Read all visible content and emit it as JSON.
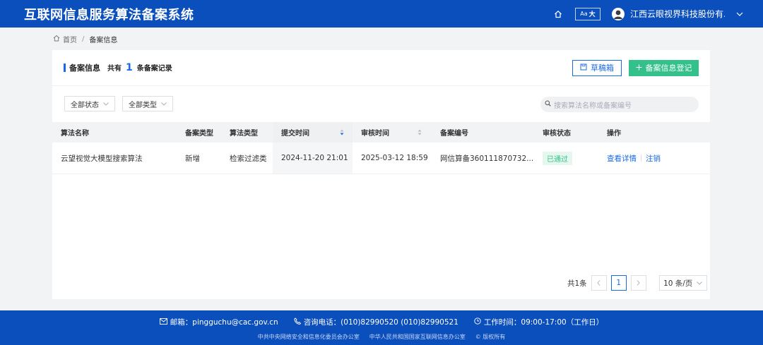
{
  "header": {
    "title": "互联网信息服务算法备案系统",
    "font_btn_small": "Aa",
    "font_btn_big": "大",
    "user_name": "江西云眼视界科技股份有..."
  },
  "breadcrumb": {
    "home": "首页",
    "separator": "/",
    "current": "备案信息"
  },
  "card": {
    "title": "备案信息",
    "total_prefix": "共有",
    "total_count": "1",
    "total_suffix": "条备案记录",
    "draft_button": "草稿箱",
    "register_button": "备案信息登记"
  },
  "filters": {
    "status": "全部状态",
    "type": "全部类型",
    "search_placeholder": "搜索算法名称或备案编号"
  },
  "table": {
    "headers": [
      "算法名称",
      "备案类型",
      "算法类型",
      "提交时间",
      "审核时间",
      "备案编号",
      "审核状态",
      "操作"
    ],
    "rows": [
      {
        "name": "云望视觉大模型搜索算法",
        "record_type": "新增",
        "algo_type": "检索过滤类",
        "submit_time": "2024-11-20 21:01",
        "review_time": "2025-03-12 18:59",
        "record_no": "网信算备360111870732...",
        "status": "已通过",
        "action_view": "查看详情",
        "action_cancel": "注销"
      }
    ]
  },
  "pagination": {
    "total": "共1条",
    "current_page": "1",
    "page_size": "10 条/页"
  },
  "footer": {
    "email": "邮箱：pingguchu@cac.gov.cn",
    "phone": "咨询电话：(010)82990520   (010)82990521",
    "hours": "工作时间：09:00-17:00（工作日）",
    "org1": "中共中央网络安全和信息化委员会办公室",
    "org2": "中华人民共和国国家互联网信息办公室",
    "copyright": "版权所有"
  },
  "colors": {
    "primary": "#0b4fbd",
    "accent": "#1a6ae6",
    "success": "#33c08a"
  }
}
